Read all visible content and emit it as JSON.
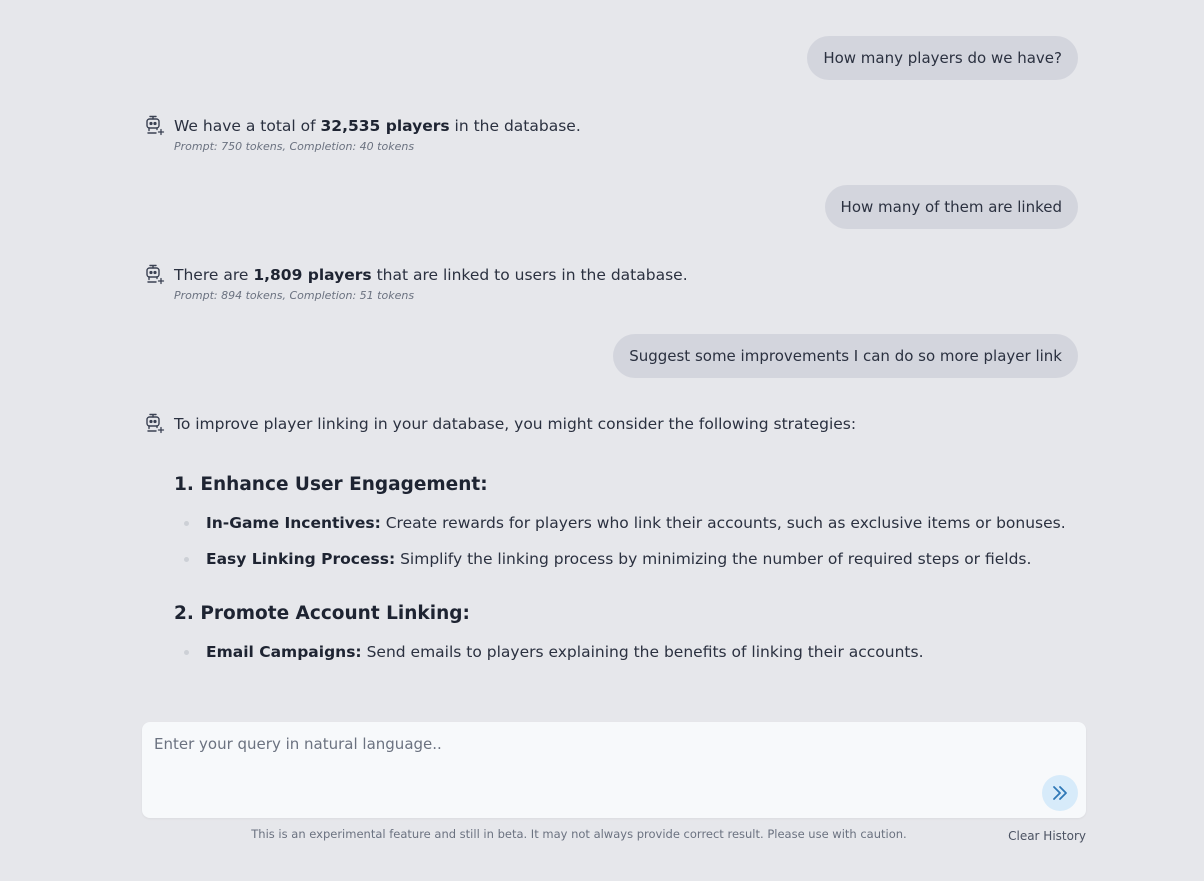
{
  "messages": {
    "q1": "How many players do we have?",
    "a1": {
      "pre": "We have a total of ",
      "bold": "32,535 players",
      "post": " in the database.",
      "meta": "Prompt: 750 tokens, Completion: 40 tokens"
    },
    "q2": "How many of them are linked",
    "a2": {
      "pre": "There are ",
      "bold": "1,809 players",
      "post": " that are linked to users in the database.",
      "meta": "Prompt: 894 tokens, Completion: 51 tokens"
    },
    "q3": "Suggest some improvements I can do so more player link",
    "a3": {
      "intro": "To improve player linking in your database, you might consider the following strategies:",
      "sections": [
        {
          "heading": "1. Enhance User Engagement:",
          "items": [
            {
              "label": "In-Game Incentives:",
              "text": " Create rewards for players who link their accounts, such as exclusive items or bonuses."
            },
            {
              "label": "Easy Linking Process:",
              "text": " Simplify the linking process by minimizing the number of required steps or fields."
            }
          ]
        },
        {
          "heading": "2. Promote Account Linking:",
          "items": [
            {
              "label": "Email Campaigns:",
              "text": " Send emails to players explaining the benefits of linking their accounts."
            }
          ]
        }
      ]
    }
  },
  "input": {
    "placeholder": "Enter your query in natural language..",
    "send_icon": "double-chevron-right-icon"
  },
  "footer": {
    "disclaimer": "This is an experimental feature and still in beta. It may not always provide correct result. Please use with caution.",
    "clear_history": "Clear History"
  },
  "colors": {
    "background": "#e6e7eb",
    "user_bubble": "#d3d5dd",
    "input_bg": "#f7f9fb",
    "send_button": "#d7ebfa",
    "send_icon": "#2f78b7"
  }
}
